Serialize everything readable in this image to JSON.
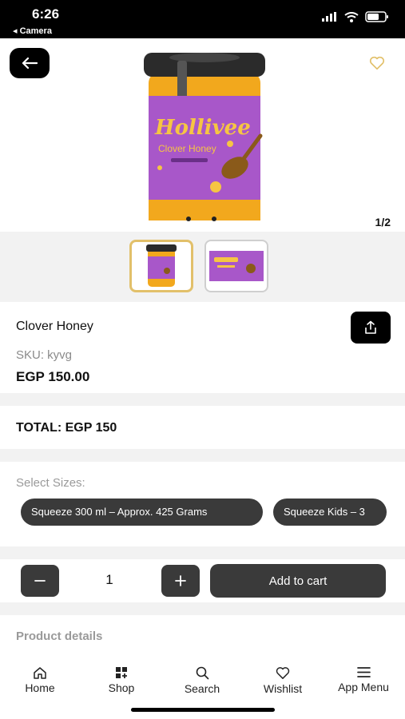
{
  "status_bar": {
    "time": "6:26",
    "back_app": "◂ Camera"
  },
  "product": {
    "name": "Clover Honey",
    "sku": "SKU: kyvg",
    "price": "EGP 150.00",
    "pager": "1/2",
    "image_brand": "Hollivee",
    "image_label": "Clover Honey"
  },
  "total": {
    "text": "TOTAL: EGP 150"
  },
  "sizes": {
    "label": "Select Sizes:",
    "options": [
      "Squeeze  300 ml – Approx. 425 Grams",
      "Squeeze  Kids – 3"
    ]
  },
  "cart": {
    "quantity": "1",
    "add_label": "Add to cart"
  },
  "details": {
    "label": "Product details"
  },
  "nav": {
    "items": [
      {
        "label": "Home",
        "icon": "home-icon"
      },
      {
        "label": "Shop",
        "icon": "shop-icon"
      },
      {
        "label": "Search",
        "icon": "search-icon"
      },
      {
        "label": "Wishlist",
        "icon": "heart-icon"
      },
      {
        "label": "App Menu",
        "icon": "menu-icon"
      }
    ]
  },
  "colors": {
    "accent_gold": "#e2c06a",
    "dark_button": "#3a3a3a",
    "label_purple": "#a857c9",
    "honey": "#f2a81d"
  }
}
